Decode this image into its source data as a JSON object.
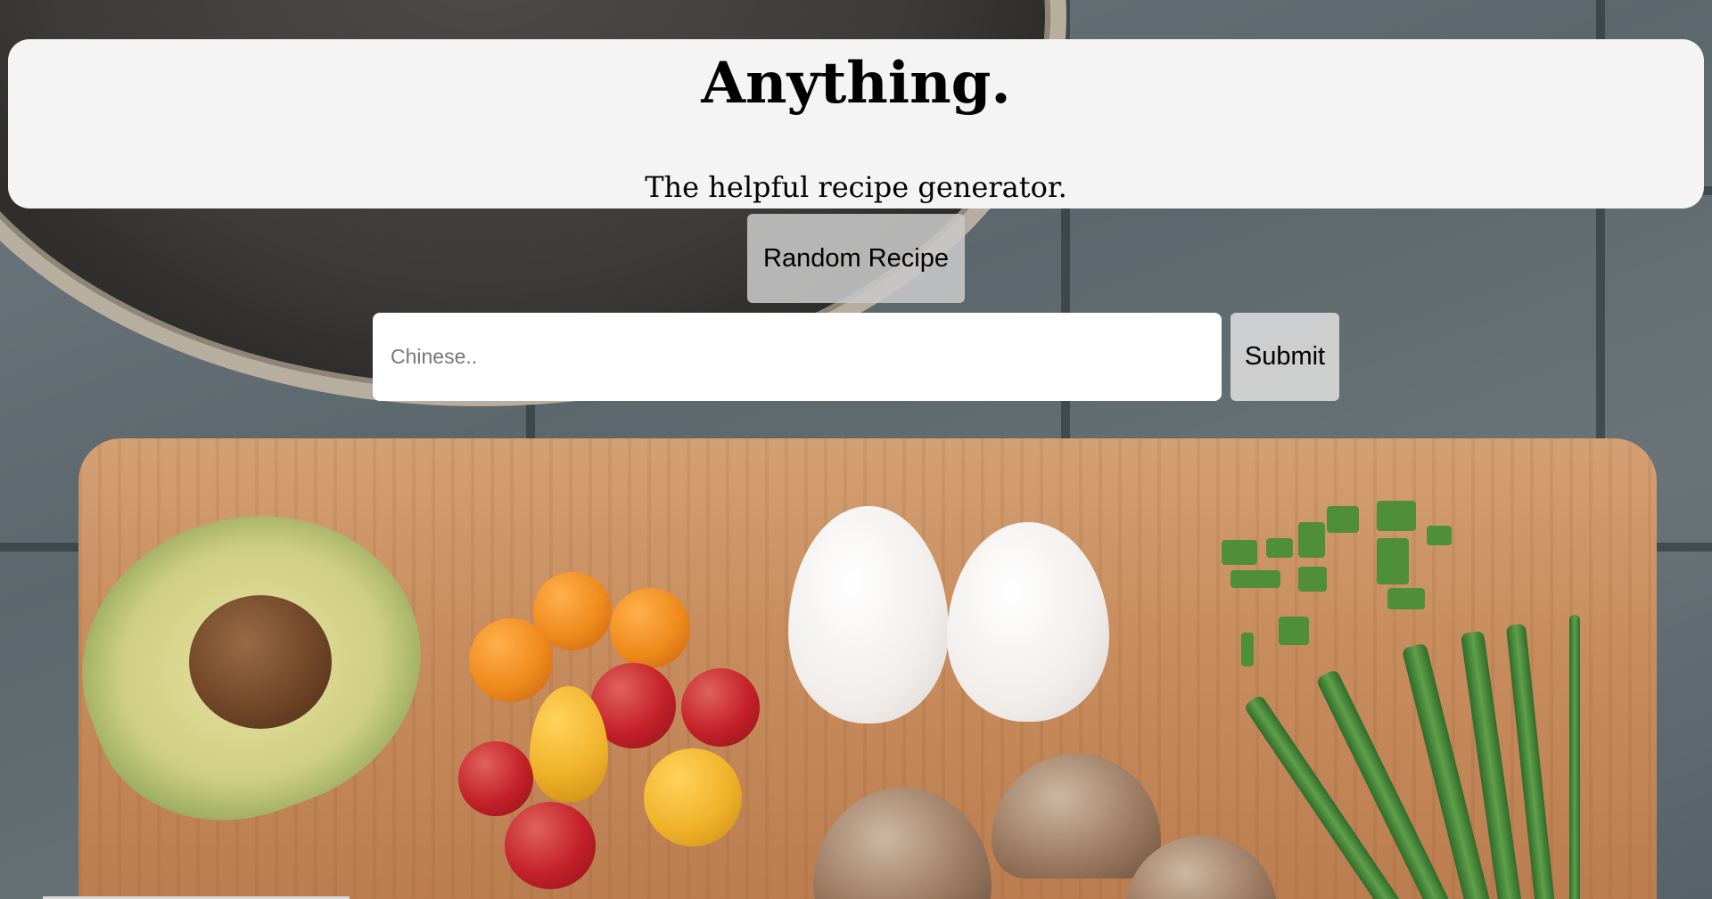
{
  "header": {
    "title": "Anything.",
    "subtitle": "The helpful recipe generator."
  },
  "controls": {
    "random_label": "Random Recipe",
    "search_placeholder": "Chinese..",
    "search_value": "",
    "submit_label": "Submit"
  },
  "background": {
    "icon": "food-ingredients-photo",
    "description_colors": {
      "header_bg": "#f4f4f4",
      "button_bg": "#c8c8c8"
    }
  }
}
